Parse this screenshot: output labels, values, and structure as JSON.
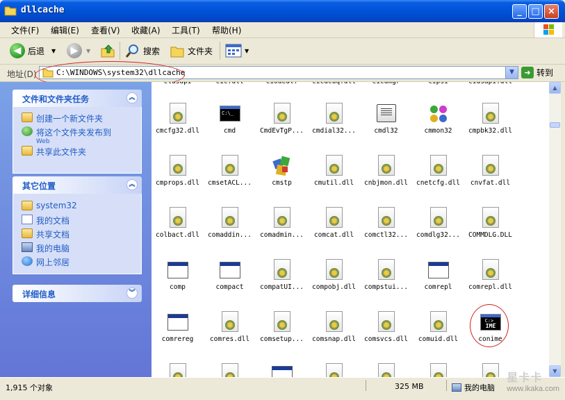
{
  "window": {
    "title": "dllcache",
    "buttons": {
      "minimize": "_",
      "maximize": "□",
      "close": "×"
    }
  },
  "menubar": {
    "items": [
      "文件(F)",
      "编辑(E)",
      "查看(V)",
      "收藏(A)",
      "工具(T)",
      "帮助(H)"
    ]
  },
  "toolbar": {
    "back_label": "后退",
    "search_label": "搜索",
    "folders_label": "文件夹"
  },
  "address": {
    "label": "地址(D)",
    "value": "C:\\WINDOWS\\system32\\dllcache",
    "go_label": "转到"
  },
  "tasks_panel": {
    "title": "文件和文件夹任务",
    "items": [
      {
        "label": "创建一个新文件夹",
        "icon": "new-folder-icon"
      },
      {
        "label": "将这个文件夹发布到",
        "sub": "Web",
        "icon": "publish-web-icon"
      },
      {
        "label": "共享此文件夹",
        "icon": "share-folder-icon"
      }
    ]
  },
  "places_panel": {
    "title": "其它位置",
    "items": [
      {
        "label": "system32",
        "icon": "folder-icon"
      },
      {
        "label": "我的文档",
        "icon": "my-documents-icon"
      },
      {
        "label": "共享文档",
        "icon": "shared-documents-icon"
      },
      {
        "label": "我的电脑",
        "icon": "my-computer-icon"
      },
      {
        "label": "网上邻居",
        "icon": "network-places-icon"
      }
    ]
  },
  "details_panel": {
    "title": "详细信息"
  },
  "partial_top_names": [
    "clusapi",
    "cic.dll",
    "ciodeul.",
    "cicdcuq.dll",
    "cicdmgr",
    "cipsi",
    "cidsapi.dll"
  ],
  "files": [
    [
      {
        "name": "cmcfg32.dll",
        "icon": "dll"
      },
      {
        "name": "cmd",
        "icon": "cmd"
      },
      {
        "name": "CmdEvTgP...",
        "icon": "dll"
      },
      {
        "name": "cmdial32...",
        "icon": "dll"
      },
      {
        "name": "cmdl32",
        "icon": "book"
      },
      {
        "name": "cmmon32",
        "icon": "monitor"
      },
      {
        "name": "cmpbk32.dll",
        "icon": "dll"
      }
    ],
    [
      {
        "name": "cmprops.dll",
        "icon": "dll"
      },
      {
        "name": "cmsetACL...",
        "icon": "dll"
      },
      {
        "name": "cmstp",
        "icon": "cmstp"
      },
      {
        "name": "cmutil.dll",
        "icon": "dll"
      },
      {
        "name": "cnbjmon.dll",
        "icon": "dll"
      },
      {
        "name": "cnetcfg.dll",
        "icon": "dll"
      },
      {
        "name": "cnvfat.dll",
        "icon": "dll"
      }
    ],
    [
      {
        "name": "colbact.dll",
        "icon": "dll"
      },
      {
        "name": "comaddin...",
        "icon": "dll"
      },
      {
        "name": "comadmin...",
        "icon": "dll"
      },
      {
        "name": "comcat.dll",
        "icon": "dll"
      },
      {
        "name": "comctl32...",
        "icon": "dll"
      },
      {
        "name": "comdlg32...",
        "icon": "dll"
      },
      {
        "name": "COMMDLG.DLL",
        "icon": "dll"
      }
    ],
    [
      {
        "name": "comp",
        "icon": "window"
      },
      {
        "name": "compact",
        "icon": "window"
      },
      {
        "name": "compatUI...",
        "icon": "dll"
      },
      {
        "name": "compobj.dll",
        "icon": "dll"
      },
      {
        "name": "compstui...",
        "icon": "dll"
      },
      {
        "name": "comrepl",
        "icon": "window"
      },
      {
        "name": "comrepl.dll",
        "icon": "dll"
      }
    ],
    [
      {
        "name": "comrereg",
        "icon": "window"
      },
      {
        "name": "comres.dll",
        "icon": "dll"
      },
      {
        "name": "comsetup...",
        "icon": "dll"
      },
      {
        "name": "comsnap.dll",
        "icon": "dll"
      },
      {
        "name": "comsvcs.dll",
        "icon": "dll"
      },
      {
        "name": "comuid.dll",
        "icon": "dll"
      },
      {
        "name": "conime",
        "icon": "ime"
      }
    ]
  ],
  "status": {
    "count": "1,915 个对象",
    "size": "325 MB",
    "location": "我的电脑"
  },
  "watermark": {
    "logo": "星卡卡",
    "url": "www.ikaka.com"
  },
  "colors": {
    "titlebar": "#0052d6",
    "sidebar": "#6b8be0",
    "link": "#215dc6",
    "annotation": "#d42020"
  }
}
